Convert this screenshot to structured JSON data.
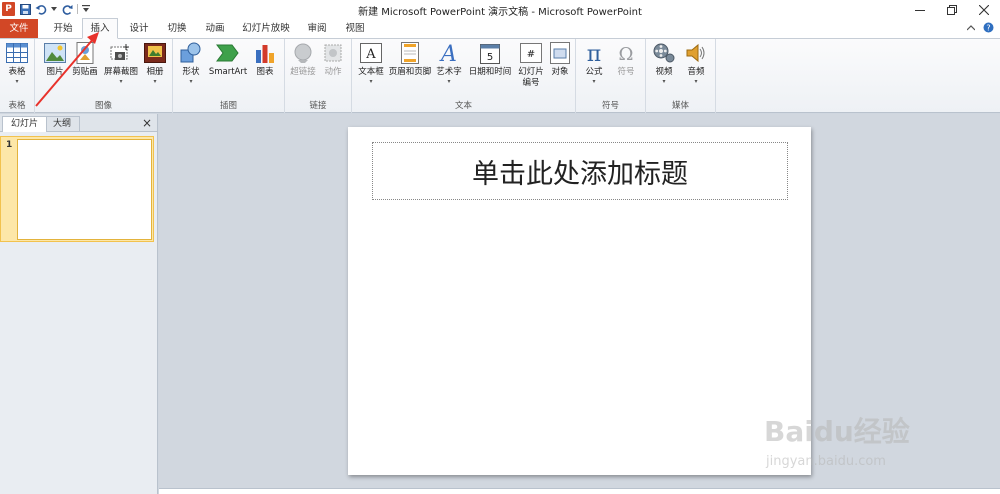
{
  "window": {
    "title": "新建 Microsoft PowerPoint 演示文稿 - Microsoft PowerPoint",
    "app_icon_letter": "P"
  },
  "tabs": [
    {
      "label": "文件",
      "left": 0
    },
    {
      "label": "开始"
    },
    {
      "label": "插入"
    },
    {
      "label": "设计"
    },
    {
      "label": "切换"
    },
    {
      "label": "动画"
    },
    {
      "label": "幻灯片放映"
    },
    {
      "label": "审阅"
    },
    {
      "label": "视图"
    }
  ],
  "ribbon": {
    "groups": {
      "table": "表格",
      "images": "图像",
      "illustrations": "插图",
      "links": "链接",
      "text": "文本",
      "symbols": "符号",
      "media": "媒体"
    },
    "buttons": {
      "table": "表格",
      "picture": "图片",
      "clipart": "剪贴画",
      "screenshot": "屏幕截图",
      "album": "相册",
      "shapes": "形状",
      "smartart": "SmartArt",
      "chart": "图表",
      "hyperlink": "超链接",
      "action": "动作",
      "textbox": "文本框",
      "header_footer": "页眉和页脚",
      "wordart": "艺术字",
      "datetime": "日期和时间",
      "slide_number_1": "幻灯片",
      "slide_number_2": "编号",
      "object": "对象",
      "equation": "公式",
      "symbol": "符号",
      "video": "视频",
      "audio": "音频"
    }
  },
  "left_pane": {
    "tab_slides": "幻灯片",
    "tab_outline": "大纲",
    "close": "×",
    "slide_number": "1"
  },
  "slide": {
    "title_placeholder": "单击此处添加标题"
  },
  "watermark": {
    "logo": "Baidu经验",
    "url": "jingyan.baidu.com"
  },
  "colors": {
    "file_tab": "#d24726",
    "annotation_arrow": "#e8322b"
  }
}
